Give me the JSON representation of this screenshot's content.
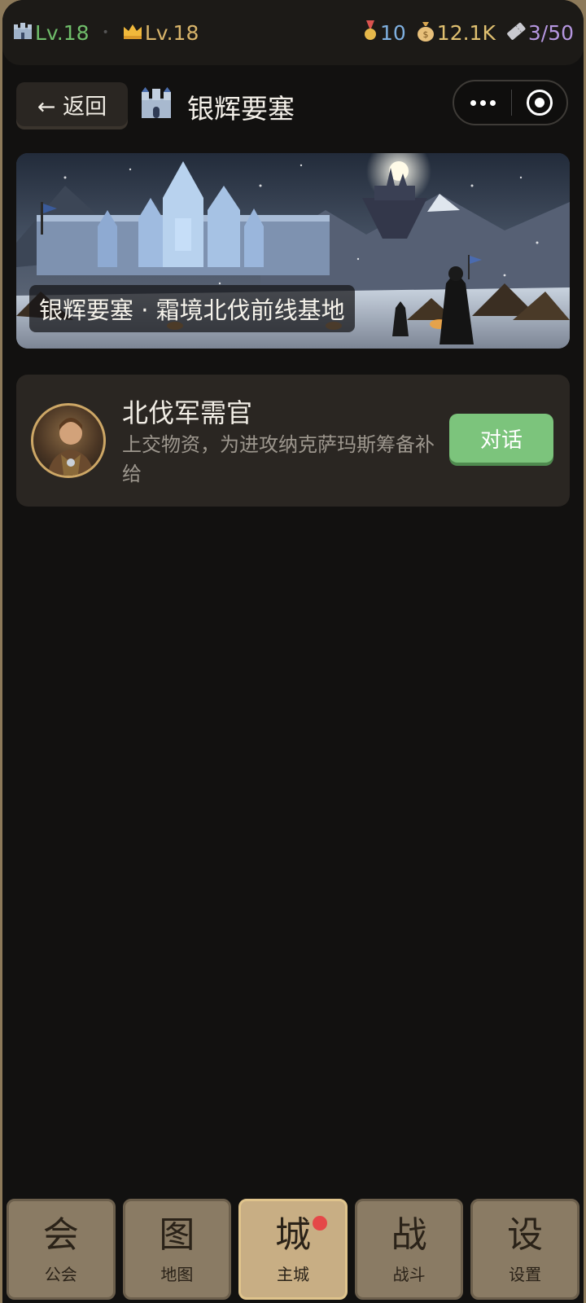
{
  "status_bar": {
    "castle_level": "Lv.18",
    "crown_level": "Lv.18",
    "medals": "10",
    "coins": "12.1K",
    "tickets": "3/50",
    "icons": [
      "castle-icon",
      "crown-icon",
      "medal-icon",
      "moneybag-icon",
      "ticket-icon"
    ],
    "colors": {
      "green": "#6fbd6a",
      "gold": "#d8b46a",
      "blue": "#7fb0e0",
      "purple": "#b596e0"
    }
  },
  "header": {
    "back_label": "← 返回",
    "title": "银辉要塞"
  },
  "banner": {
    "caption": "银辉要塞 · 霜境北伐前线基地"
  },
  "npc": {
    "name": "北伐军需官",
    "description": "上交物资，为进攻纳克萨玛斯筹备补给",
    "action_label": "对话"
  },
  "nav": {
    "tabs": [
      {
        "glyph": "会",
        "label": "公会"
      },
      {
        "glyph": "图",
        "label": "地图"
      },
      {
        "glyph": "城",
        "label": "主城",
        "active": true,
        "badge": true
      },
      {
        "glyph": "战",
        "label": "战斗"
      },
      {
        "glyph": "设",
        "label": "设置"
      }
    ]
  }
}
